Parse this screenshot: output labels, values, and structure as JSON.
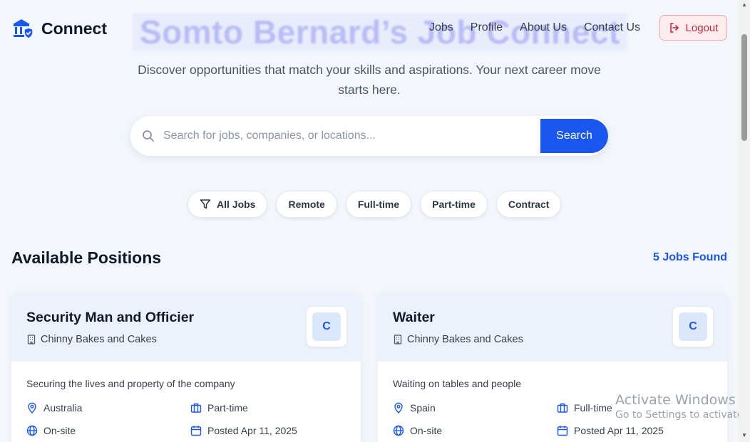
{
  "header": {
    "hero_title": "Somto Bernard’s Job Connect",
    "brand": "Connect",
    "nav": [
      "Jobs",
      "Profile",
      "About Us",
      "Contact Us"
    ],
    "logout_label": "Logout"
  },
  "tagline": "Discover opportunities that match your skills and aspirations. Your next career move starts here.",
  "search": {
    "placeholder": "Search for jobs, companies, or locations...",
    "value": "",
    "button_label": "Search"
  },
  "filters": [
    "All Jobs",
    "Remote",
    "Full-time",
    "Part-time",
    "Contract"
  ],
  "section": {
    "title": "Available Positions",
    "count_label": "5 Jobs Found"
  },
  "jobs": [
    {
      "title": "Security Man and Officier",
      "company": "Chinny Bakes and Cakes",
      "logo_letter": "C",
      "description": "Securing the lives and property of the company",
      "location": "Australia",
      "job_type": "Part-time",
      "work_mode": "On-site",
      "posted": "Posted Apr 11, 2025"
    },
    {
      "title": "Waiter",
      "company": "Chinny Bakes and Cakes",
      "logo_letter": "C",
      "description": "Waiting on tables and people",
      "location": "Spain",
      "job_type": "Full-time",
      "work_mode": "On-site",
      "posted": "Posted Apr 11, 2025"
    }
  ],
  "watermark": {
    "line1": "Activate Windows",
    "line2": "Go to Settings to activate Windows."
  },
  "colors": {
    "accent": "#1a56f0",
    "logout": "#c0283b",
    "background": "#f3f7fc"
  }
}
